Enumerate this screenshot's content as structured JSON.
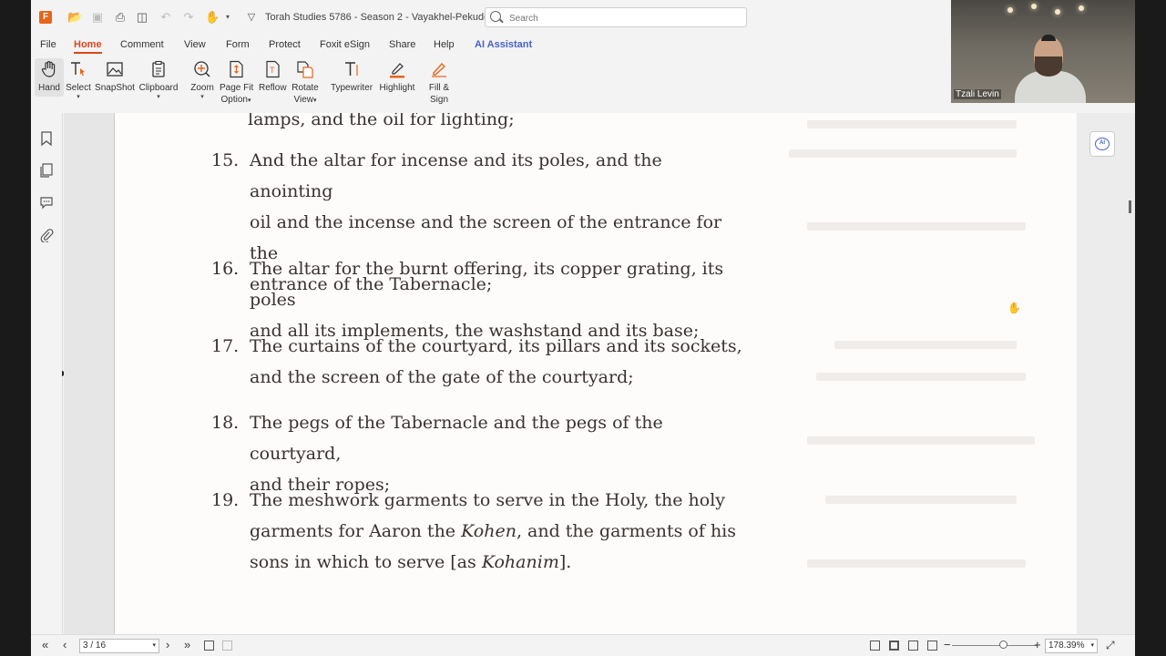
{
  "window": {
    "app_logo": "F",
    "title": "Torah Studies 5786 - Season 2 - Vayakhel-Pekudei.pdf...",
    "search_placeholder": "Search"
  },
  "menu": [
    "File",
    "Home",
    "Comment",
    "View",
    "Form",
    "Protect",
    "Foxit eSign",
    "Share",
    "Help",
    "AI Assistant"
  ],
  "ribbon": {
    "hand": "Hand",
    "select": "Select",
    "snapshot": "SnapShot",
    "clipboard": "Clipboard",
    "zoom": "Zoom",
    "page_fit_1": "Page Fit",
    "page_fit_2": "Option",
    "reflow": "Reflow",
    "rotate_1": "Rotate",
    "rotate_2": "View",
    "typewriter": "Typewriter",
    "highlight": "Highlight",
    "fill_1": "Fill &",
    "fill_2": "Sign"
  },
  "document": {
    "cut_line": "lamps, and the oil for lighting;",
    "verses": [
      {
        "num": "15.",
        "lines": [
          "And the altar for incense and its poles, and the anointing",
          "oil and the incense and the screen of the entrance for the",
          "entrance of the Tabernacle;"
        ]
      },
      {
        "num": "16.",
        "lines": [
          "The altar for the burnt offering, its copper grating, its poles",
          "and all its implements, the washstand and its base;"
        ]
      },
      {
        "num": "17.",
        "lines": [
          "The curtains of the courtyard, its pillars and its sockets,",
          "and the screen of the gate of the courtyard;"
        ]
      },
      {
        "num": "18.",
        "lines": [
          "The pegs of the Tabernacle and the pegs of the courtyard,",
          "and their ropes;"
        ]
      },
      {
        "num": "19.",
        "line1": "The meshwork garments to serve in the Holy, the holy",
        "line2a": "garments for Aaron the ",
        "line2b": "Kohen",
        "line2c": ", and the garments of his",
        "line3a": "sons in which to serve [as ",
        "line3b": "Kohanim",
        "line3c": "]."
      }
    ]
  },
  "status": {
    "page_field": "3 / 16",
    "zoom_value": "178.39%"
  },
  "webcam": {
    "participant_name": "Tzali Levin"
  }
}
